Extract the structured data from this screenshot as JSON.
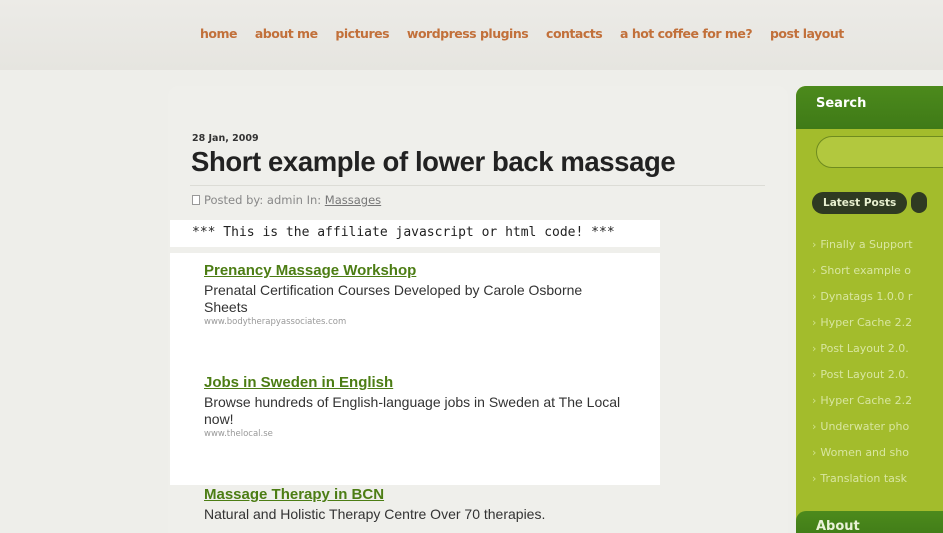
{
  "nav": {
    "items": [
      "home",
      "about me",
      "pictures",
      "wordpress plugins",
      "contacts",
      "a hot coffee for me?",
      "post layout"
    ]
  },
  "post": {
    "date": "28 Jan, 2009",
    "title": "Short example of lower back massage",
    "posted_by_prefix": "Posted by: admin In: ",
    "category": "Massages",
    "affiliate_text": "*** This is the affiliate javascript or html code! ***"
  },
  "ads": [
    {
      "title": "Prenancy Massage Workshop",
      "description": "Prenatal Certification Courses Developed by Carole Osborne Sheets",
      "url": "www.bodytherapyassociates.com"
    },
    {
      "title": "Jobs in Sweden in English",
      "description": "Browse hundreds of English-language jobs in Sweden at The Local now!",
      "url": "www.thelocal.se"
    },
    {
      "title": "Massage Therapy in BCN",
      "description": "Natural and Holistic Therapy Centre Over 70 therapies."
    }
  ],
  "sidebar": {
    "search_heading": "Search",
    "tabs": [
      "Latest Posts",
      ""
    ],
    "latest_posts": [
      "Finally a Support",
      "Short example o",
      "Dynatags 1.0.0 r",
      "Hyper Cache 2.2",
      "Post Layout 2.0.",
      "Post Layout 2.0.",
      "Hyper Cache 2.2",
      "Underwater pho",
      "Women and sho",
      "Translation task"
    ],
    "about_heading": "About"
  }
}
